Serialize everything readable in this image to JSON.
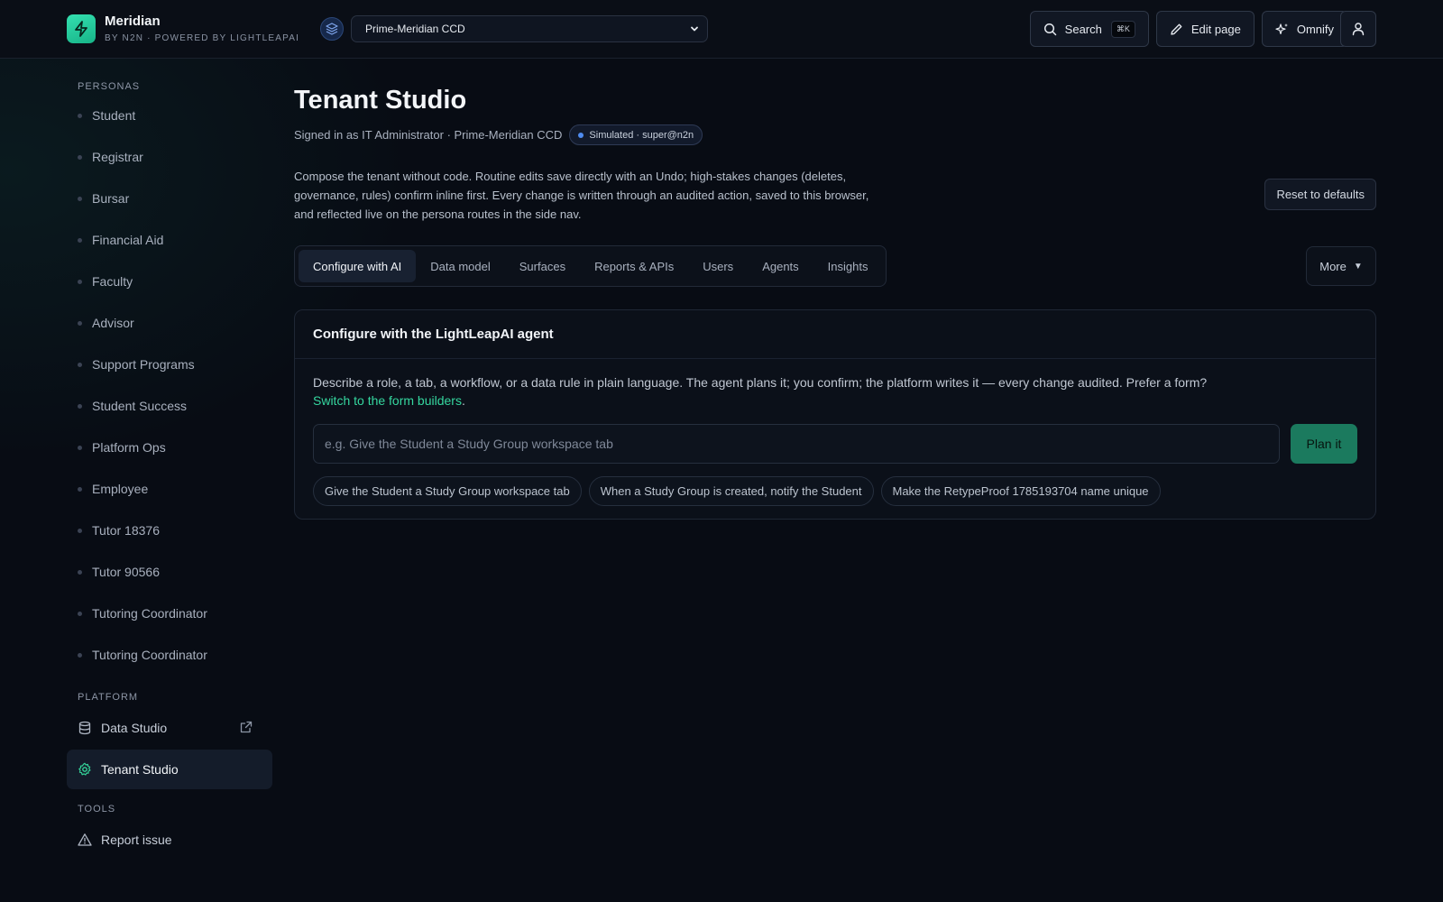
{
  "brand": {
    "name": "Meridian",
    "subtitle": "BY N2N · POWERED BY LIGHTLEAPAI"
  },
  "tenant": {
    "selected": "Prime-Meridian CCD"
  },
  "top_actions": {
    "search_label": "Search",
    "search_kbd": "⌘K",
    "edit_label": "Edit page",
    "omnify_label": "Omnify"
  },
  "sidebar": {
    "personas_label": "PERSONAS",
    "personas": [
      "Student",
      "Registrar",
      "Bursar",
      "Financial Aid",
      "Faculty",
      "Advisor",
      "Support Programs",
      "Student Success",
      "Platform Ops",
      "Employee",
      "Tutor 18376",
      "Tutor 90566",
      "Tutoring Coordinator",
      "Tutoring Coordinator"
    ],
    "platform_label": "PLATFORM",
    "platform": [
      {
        "label": "Data Studio",
        "icon": "database-icon"
      },
      {
        "label": "Tenant Studio",
        "icon": "gear-icon",
        "active": true
      }
    ],
    "tools_label": "TOOLS",
    "tools": [
      {
        "label": "Report issue",
        "icon": "warning-icon"
      }
    ]
  },
  "main": {
    "title": "Tenant Studio",
    "signed_in": "Signed in as IT Administrator · Prime-Meridian CCD",
    "sim_badge": "Simulated · super@n2n",
    "description": "Compose the tenant without code. Routine edits save directly with an Undo; high-stakes changes (deletes, governance, rules) confirm inline first. Every change is written through an audited action, saved to this browser, and reflected live on the persona routes in the side nav.",
    "reset_label": "Reset to defaults",
    "tabs": [
      "Configure with AI",
      "Data model",
      "Surfaces",
      "Reports & APIs",
      "Users",
      "Agents",
      "Insights"
    ],
    "more_label": "More"
  },
  "card": {
    "title": "Configure with the LightLeapAI agent",
    "desc": "Describe a role, a tab, a workflow, or a data rule in plain language. The agent plans it; you confirm; the platform writes it — every change audited. Prefer a form?",
    "link_text": "Switch to the form builders",
    "placeholder": "e.g. Give the Student a Study Group workspace tab",
    "plan_label": "Plan it",
    "chips": [
      "Give the Student a Study Group workspace tab",
      "When a Study Group is created, notify the Student",
      "Make the RetypeProof 1785193704 name unique"
    ]
  },
  "colors": {
    "accent": "#34d399",
    "background": "#080c14",
    "plan_button": "#1b7a5e"
  }
}
